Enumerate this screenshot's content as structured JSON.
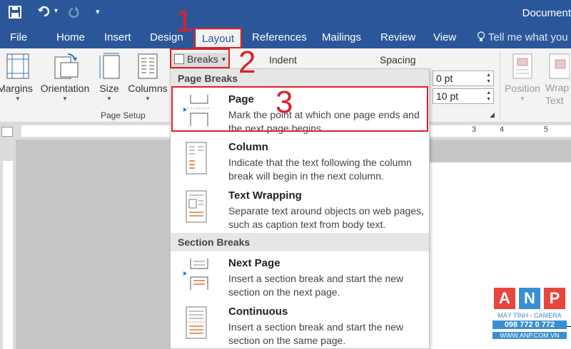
{
  "title_bar": {
    "doc_title": "Document"
  },
  "tabs": [
    {
      "label": "File"
    },
    {
      "label": "Home"
    },
    {
      "label": "Insert"
    },
    {
      "label": "Design"
    },
    {
      "label": "Layout"
    },
    {
      "label": "References"
    },
    {
      "label": "Mailings"
    },
    {
      "label": "Review"
    },
    {
      "label": "View"
    }
  ],
  "tell_me": "Tell me what you",
  "ribbon": {
    "margins": "Margins",
    "orientation": "Orientation",
    "size": "Size",
    "columns": "Columns",
    "page_setup_label": "Page Setup",
    "breaks": "Breaks",
    "indent_label": "Indent",
    "spacing_label": "Spacing",
    "spacing_before": "0 pt",
    "spacing_after": "10 pt",
    "position": "Position",
    "wrap_text_line1": "Wrap",
    "wrap_text_line2": "Text"
  },
  "ruler": {
    "marks": [
      "3",
      "4",
      "5"
    ]
  },
  "dropdown": {
    "page_breaks_header": "Page Breaks",
    "section_breaks_header": "Section Breaks",
    "items": [
      {
        "title": "Page",
        "desc": "Mark the point at which one page ends and the next page begins."
      },
      {
        "title": "Column",
        "desc": "Indicate that the text following the column break will begin in the next column."
      },
      {
        "title": "Text Wrapping",
        "desc": "Separate text around objects on web pages, such as caption text from body text."
      },
      {
        "title": "Next Page",
        "desc": "Insert a section break and start the new section on the next page."
      },
      {
        "title": "Continuous",
        "desc": "Insert a section break and start the new section on the same page."
      }
    ]
  },
  "callouts": {
    "one": "1",
    "two": "2",
    "three": "3"
  },
  "watermark": {
    "letters": [
      "A",
      "N",
      "P"
    ],
    "line1": "MÁY TÍNH - CAMERA",
    "line2": "098 772 0 772",
    "line3": "WWW.ANP.COM.VN"
  },
  "colors": {
    "accent": "#2b579a",
    "callout": "#d8222a"
  }
}
